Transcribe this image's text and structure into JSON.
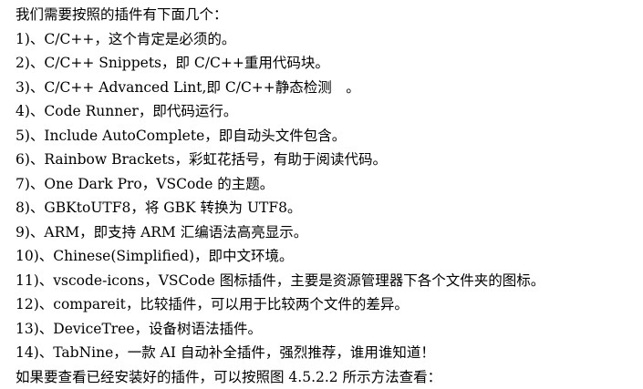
{
  "document": {
    "intro": "我们需要按照的插件有下面几个：",
    "items": [
      "1)、C/C++，这个肯定是必须的。",
      "2)、C/C++ Snippets，即 C/C++重用代码块。",
      "3)、C/C++ Advanced Lint,即 C/C++静态检测　。",
      "4)、Code Runner，即代码运行。",
      "5)、Include AutoComplete，即自动头文件包含。",
      "6)、Rainbow Brackets，彩虹花括号，有助于阅读代码。",
      "7)、One Dark Pro，VSCode 的主题。",
      "8)、GBKtoUTF8，将 GBK 转换为 UTF8。",
      "9)、ARM，即支持 ARM 汇编语法高亮显示。",
      "10)、Chinese(Simplified)，即中文环境。",
      "11)、vscode-icons，VSCode 图标插件，主要是资源管理器下各个文件夹的图标。",
      "12)、compareit，比较插件，可以用于比较两个文件的差异。",
      "13)、DeviceTree，设备树语法插件。",
      "14)、TabNine，一款 AI 自动补全插件，强烈推荐，谁用谁知道！"
    ],
    "outro": "如果要查看已经安装好的插件，可以按照图 4.5.2.2 所示方法查看："
  }
}
